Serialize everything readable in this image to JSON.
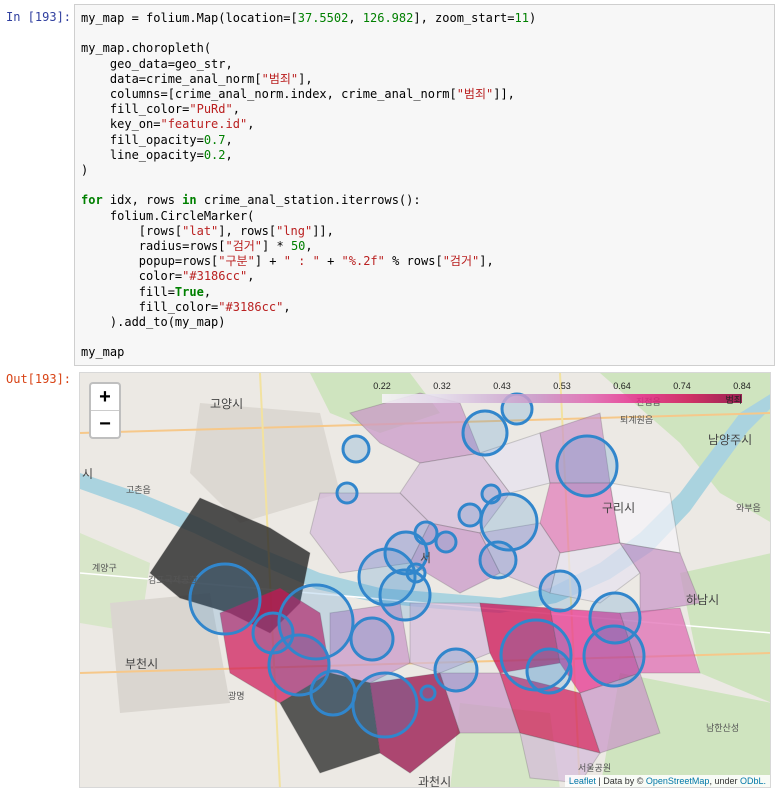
{
  "prompts": {
    "input": "In [193]:",
    "output": "Out[193]:"
  },
  "code_lines": [
    "my_map = folium.Map(location=[37.5502, 126.982], zoom_start=11)",
    "",
    "my_map.choropleth(",
    "    geo_data=geo_str,",
    "    data=crime_anal_norm[\"범죄\"],",
    "    columns=[crime_anal_norm.index, crime_anal_norm[\"범죄\"]],",
    "    fill_color=\"PuRd\",",
    "    key_on=\"feature.id\",",
    "    fill_opacity=0.7,",
    "    line_opacity=0.2,",
    ")",
    "",
    "for idx, rows in crime_anal_station.iterrows():",
    "    folium.CircleMarker(",
    "        [rows[\"lat\"], rows[\"lng\"]],",
    "        radius=rows[\"검거\"] * 50,",
    "        popup=rows[\"구분\"] + \" : \" + \"%.2f\" % rows[\"검거\"],",
    "        color=\"#3186cc\",",
    "        fill=True,",
    "        fill_color=\"#3186cc\",",
    "    ).add_to(my_map)",
    "",
    "my_map"
  ],
  "map": {
    "zoom_in": "+",
    "zoom_out": "−",
    "legend": {
      "ticks": [
        "0.22",
        "0.32",
        "0.43",
        "0.53",
        "0.64",
        "0.74",
        "0.84"
      ],
      "name": "범죄"
    },
    "places": {
      "goyang": "고양시",
      "namyangju": "남양주시",
      "guri": "구리시",
      "hanam": "하남시",
      "bucheon": "부천시",
      "gwacheon": "과천시",
      "gimpo_airport": "김포국제공항",
      "gwangmyeong": "광명",
      "toegyewon": "퇴계원읍",
      "gochon": "고촌읍",
      "wabu": "와부읍",
      "seoul_park": "서울공원",
      "namhansanseong": "남한산성",
      "jinjeop": "진접읍",
      "si_left": "시",
      "gyeyang": "계양구",
      "seo": "서"
    },
    "attribution": {
      "leaflet": "Leaflet",
      "sep1": " | Data by © ",
      "osm": "OpenStreetMap",
      "sep2": ", under ",
      "odbl": "ODbL."
    },
    "colors": {
      "marker": "#3186cc",
      "palette": "PuRd"
    }
  }
}
